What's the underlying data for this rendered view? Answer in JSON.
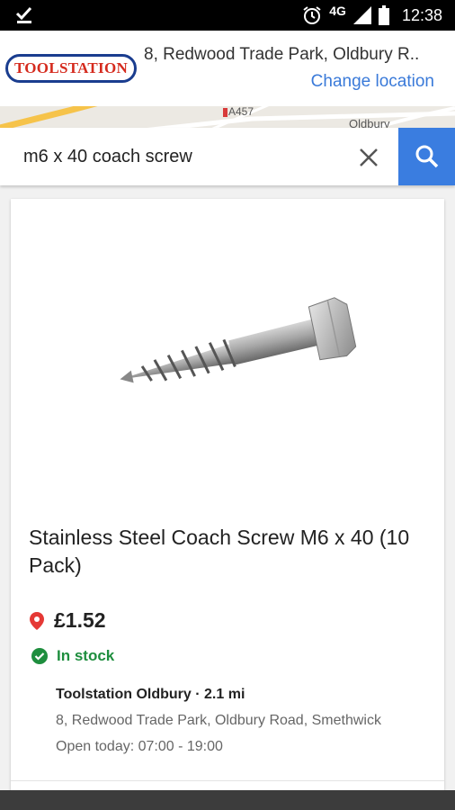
{
  "status_bar": {
    "network": "4G",
    "time": "12:38"
  },
  "header": {
    "logo_text": "TOOLSTATION",
    "address": "8, Redwood Trade Park, Oldbury R..",
    "change_location": "Change location"
  },
  "map": {
    "road_label": "A457",
    "place_label": "Oldbury"
  },
  "search": {
    "query": "m6 x 40 coach screw"
  },
  "product": {
    "title": "Stainless Steel Coach Screw M6 x 40 (10 Pack)",
    "price": "£1.52",
    "stock_status": "In stock",
    "store_name": "Toolstation Oldbury · 2.1 mi",
    "store_address": "8, Redwood Trade Park, Oldbury Road, Smethwick",
    "store_hours": "Open today: 07:00 - 19:00"
  },
  "colors": {
    "accent_blue": "#3a7de0",
    "in_stock_green": "#1e8e3e",
    "location_pin_red": "#e53935",
    "logo_red": "#d52b1e",
    "logo_blue": "#1a3d8f"
  }
}
